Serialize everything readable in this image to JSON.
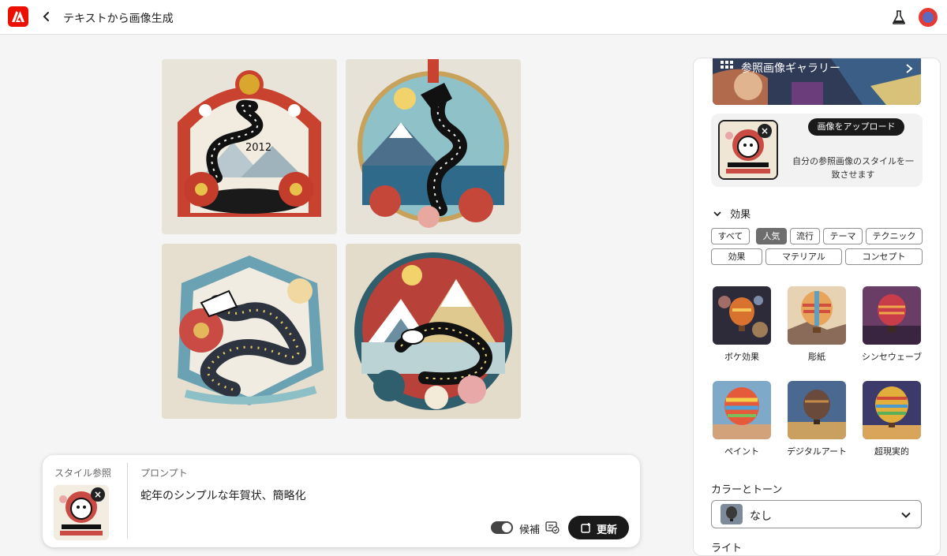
{
  "header": {
    "title": "テキストから画像生成"
  },
  "generated_images": [
    {
      "caption_text": "2012"
    },
    {
      "caption_text": ""
    },
    {
      "caption_text": ""
    },
    {
      "caption_text": ""
    }
  ],
  "prompt_bar": {
    "style_ref_label": "スタイル参照",
    "prompt_label": "プロンプト",
    "prompt_text": "蛇年のシンプルな年賀状、簡略化",
    "suggestions_label": "候補",
    "suggestions_on": true,
    "update_label": "更新"
  },
  "panel": {
    "gallery_label": "参照画像ギャラリー",
    "upload_button": "画像をアップロード",
    "upload_desc": "自分の参照画像のスタイルを一致させます",
    "effects_heading": "効果",
    "effect_chips": [
      {
        "label": "すべて",
        "active": false
      },
      {
        "label": "人気",
        "active": true
      },
      {
        "label": "流行",
        "active": false
      },
      {
        "label": "テーマ",
        "active": false
      },
      {
        "label": "テクニック",
        "active": false
      },
      {
        "label": "効果",
        "active": false
      },
      {
        "label": "マテリアル",
        "active": false
      },
      {
        "label": "コンセプト",
        "active": false
      }
    ],
    "effects": [
      {
        "label": "ボケ効果"
      },
      {
        "label": "彫紙"
      },
      {
        "label": "シンセウェーブ"
      },
      {
        "label": "ペイント"
      },
      {
        "label": "デジタルアート"
      },
      {
        "label": "超現実的"
      }
    ],
    "color_tone_heading": "カラーとトーン",
    "color_tone_value": "なし",
    "next_heading": "ライト"
  }
}
